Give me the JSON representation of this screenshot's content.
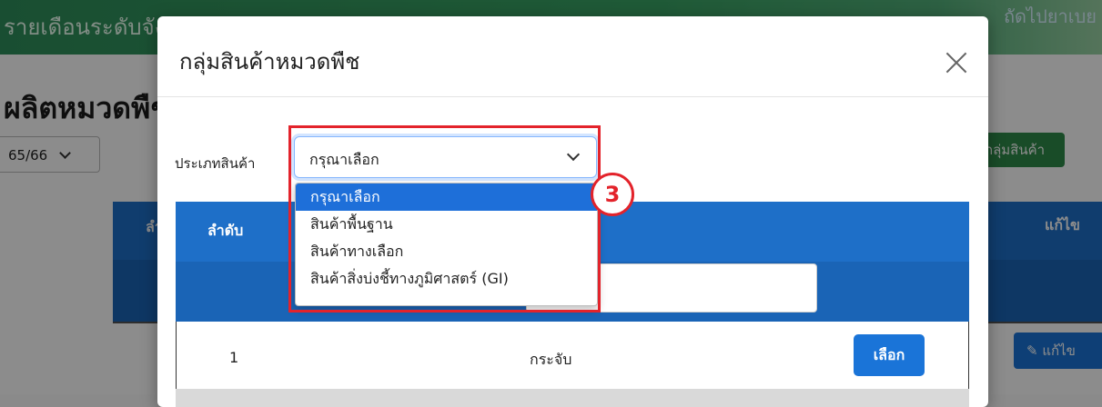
{
  "background": {
    "banner_text": "รายเดือนระดับจังหวัด",
    "banner_right_text": "ถัดไปยาเบย",
    "page_title": "ผลิตหมวดพืช",
    "year_select": "65/66",
    "add_button": "กลุ่มสินค้า",
    "table_header_left": "ลำดับ",
    "table_header_right": "แก้ไข",
    "edit_button": "แก้ไข"
  },
  "modal": {
    "title": "กลุ่มสินค้าหมวดพืช",
    "field_label": "ประเภทสินค้า",
    "select_value": "กรุณาเลือก",
    "options": [
      "กรุณาเลือก",
      "สินค้าพื้นฐาน",
      "สินค้าทางเลือก",
      "สินค้าสิ่งบ่งชี้ทางภูมิศาสตร์ (GI)"
    ],
    "selected_index": 0,
    "table": {
      "header_order": "ลำดับ",
      "rows": [
        {
          "num": "1",
          "name": "กระจับ",
          "action": "เลือก"
        }
      ]
    }
  },
  "annotation": {
    "step": "3",
    "color": "#e3232b"
  },
  "colors": {
    "primary": "#1e6fc8",
    "button": "#1a74d8",
    "green": "#2f8a4a"
  }
}
